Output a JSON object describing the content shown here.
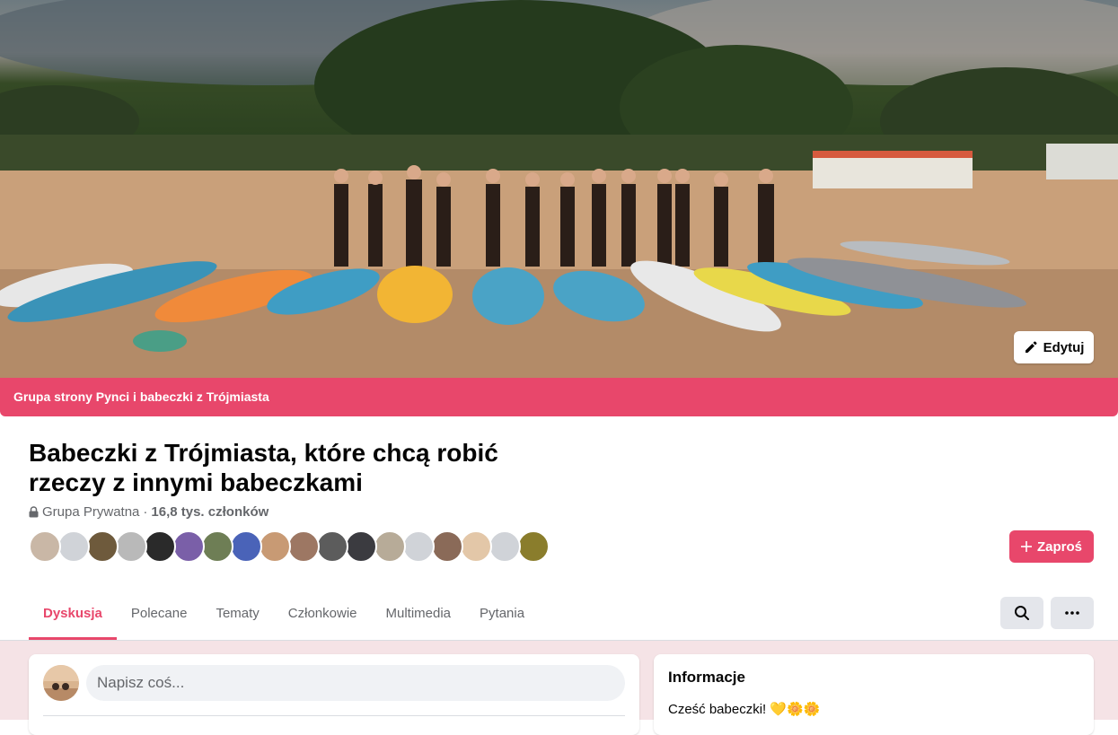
{
  "cover": {
    "edit_label": "Edytuj",
    "edit_icon": "pencil-icon"
  },
  "group_banner": "Grupa strony Pynci i babeczki z Trójmiasta",
  "group": {
    "title": "Babeczki z Trójmiasta, które chcą robić rzeczy z innymi babeczkami",
    "privacy": "Grupa Prywatna",
    "separator": "·",
    "members": "16,8 tys. członków"
  },
  "member_avatars": [
    "#c9b7a6",
    "#d0d3d8",
    "#6e5a3c",
    "#b9b9b9",
    "#2a2a2a",
    "#7a5fa8",
    "#6e7e55",
    "#4a63b8",
    "#c89a74",
    "#9d7763",
    "#5c5c5c",
    "#3b3b40",
    "#b7ab98",
    "#d0d3d8",
    "#8a6a58",
    "#e3c7a8",
    "#d0d3d8",
    "#8a7d2c"
  ],
  "invite": {
    "label": "Zaproś",
    "icon": "plus-icon"
  },
  "tabs": [
    {
      "label": "Dyskusja",
      "active": true
    },
    {
      "label": "Polecane",
      "active": false
    },
    {
      "label": "Tematy",
      "active": false
    },
    {
      "label": "Członkowie",
      "active": false
    },
    {
      "label": "Multimedia",
      "active": false
    },
    {
      "label": "Pytania",
      "active": false
    }
  ],
  "actions": {
    "search_icon": "search-icon",
    "more_icon": "more-horizontal-icon"
  },
  "composer": {
    "placeholder": "Napisz coś..."
  },
  "info": {
    "heading": "Informacje",
    "text": "Cześć babeczki! 💛🌼🌼"
  },
  "colors": {
    "accent": "#e8476b",
    "page_bg": "#f5e3e6",
    "button_grey": "#e4e6eb",
    "secondary_text": "#65676b"
  }
}
